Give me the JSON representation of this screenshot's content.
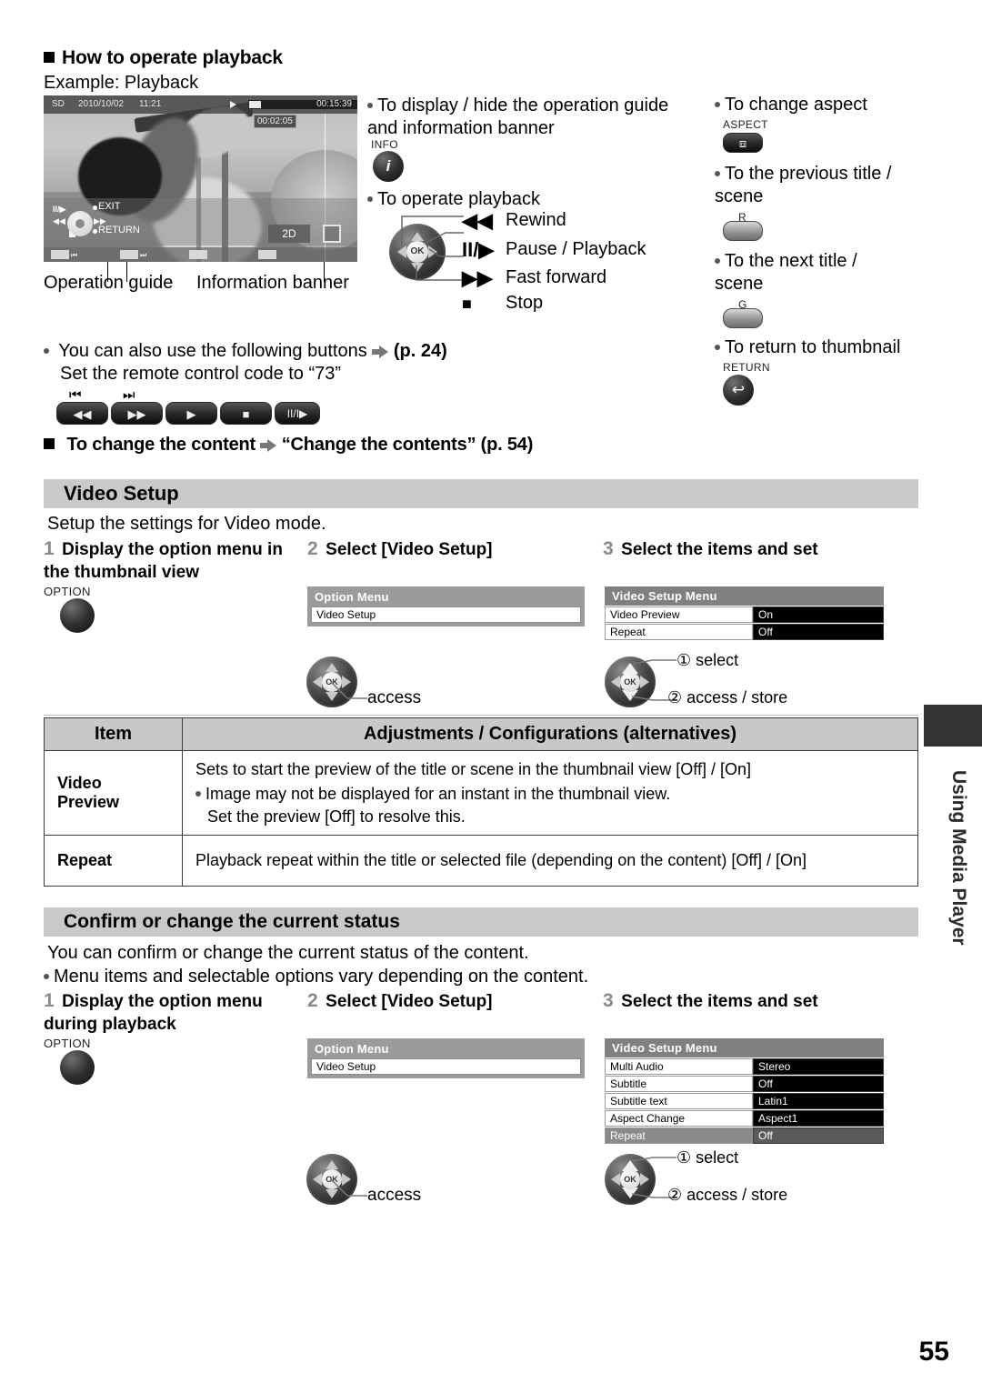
{
  "page_number": "55",
  "side_tab_label": "Using Media Player",
  "section_playback": {
    "heading": "How to operate playback",
    "example_label": "Example: Playback",
    "caption_operation_guide": "Operation guide",
    "caption_information_banner": "Information banner",
    "tv_osd": {
      "card_label": "SD",
      "date": "2010/10/02",
      "time": "11:21",
      "elapsed": "00:02:05",
      "total": "00:15:39",
      "aspect_badge": "2D",
      "guide_exit": "EXIT",
      "guide_return": "RETURN",
      "guide_pause_play": "II/▶"
    },
    "col2": {
      "bullet_display_hide": "To display / hide the operation guide and information banner",
      "info_button_label": "INFO",
      "bullet_operate_playback": "To operate playback",
      "ops": [
        {
          "glyph": "◀◀",
          "label": "Rewind"
        },
        {
          "glyph": "II/▶",
          "label": "Pause / Playback"
        },
        {
          "glyph": "▶▶",
          "label": "Fast forward"
        },
        {
          "glyph": "■",
          "label": "Stop"
        }
      ]
    },
    "col3": {
      "bullet_aspect": "To change aspect",
      "aspect_label": "ASPECT",
      "bullet_previous": "To the previous title / scene",
      "previous_key": "R",
      "bullet_next": "To the next title / scene",
      "next_key": "G",
      "bullet_return": "To return to thumbnail",
      "return_label": "RETURN"
    },
    "note_buttons_line1": "You can also use the following buttons",
    "note_buttons_ref": "(p. 24)",
    "note_buttons_line2": "Set the remote control code to “73”",
    "remote_row": {
      "skip_prev": "⏮",
      "skip_next": "⏭",
      "buttons": [
        "◀◀",
        "▶▶",
        "▶",
        "■",
        "II/I▶"
      ]
    },
    "change_content_heading": "To change the content",
    "change_content_ref": "“Change the contents” (p. 54)"
  },
  "video_setup": {
    "bar_title": "Video Setup",
    "intro": "Setup the settings for Video mode.",
    "steps": [
      {
        "num": "1",
        "text": "Display the option menu in the thumbnail view"
      },
      {
        "num": "2",
        "text": "Select [Video Setup]"
      },
      {
        "num": "3",
        "text": "Select the items and set"
      }
    ],
    "option_button_label": "OPTION",
    "option_menu": {
      "title": "Option Menu",
      "items": [
        "Video Setup"
      ]
    },
    "setup_menu": {
      "title": "Video Setup Menu",
      "rows": [
        {
          "key": "Video Preview",
          "value": "On",
          "selected": false
        },
        {
          "key": "Repeat",
          "value": "Off",
          "selected": false
        }
      ]
    },
    "access_label": "access",
    "select_label": "① select",
    "access_store_label": "② access / store"
  },
  "table": {
    "headers": [
      "Item",
      "Adjustments / Configurations (alternatives)"
    ],
    "rows": [
      {
        "item": "Video Preview",
        "desc_main": "Sets to start the preview of the title or scene in the thumbnail view [Off] / [On]",
        "desc_bullets": [
          "Image may not be displayed for an instant in the thumbnail view.",
          "Set the preview [Off] to resolve this."
        ]
      },
      {
        "item": "Repeat",
        "desc_main": "Playback repeat within the title or selected file (depending on the content) [Off] / [On]",
        "desc_bullets": []
      }
    ]
  },
  "confirm_status": {
    "bar_title": "Confirm or change the current status",
    "intro": "You can confirm or change the current status of the content.",
    "note": "Menu items and selectable options vary depending on the content.",
    "steps": [
      {
        "num": "1",
        "text": "Display the option menu during playback"
      },
      {
        "num": "2",
        "text": "Select [Video Setup]"
      },
      {
        "num": "3",
        "text": "Select the items and set"
      }
    ],
    "option_button_label": "OPTION",
    "option_menu": {
      "title": "Option Menu",
      "items": [
        "Video Setup"
      ]
    },
    "setup_menu": {
      "title": "Video Setup Menu",
      "rows": [
        {
          "key": "Multi Audio",
          "value": "Stereo",
          "selected": false
        },
        {
          "key": "Subtitle",
          "value": "Off",
          "selected": false
        },
        {
          "key": "Subtitle text",
          "value": "Latin1",
          "selected": false
        },
        {
          "key": "Aspect Change",
          "value": "Aspect1",
          "selected": false
        },
        {
          "key": "Repeat",
          "value": "Off",
          "selected": true
        }
      ]
    },
    "access_label": "access",
    "select_label": "① select",
    "access_store_label": "② access / store"
  },
  "colors": {
    "section_bar": "#c9c9c9",
    "table_header": "#c8c8c8",
    "osd_title": "#808080",
    "osd_value_bg": "#000000",
    "side_tab": "#333333"
  }
}
